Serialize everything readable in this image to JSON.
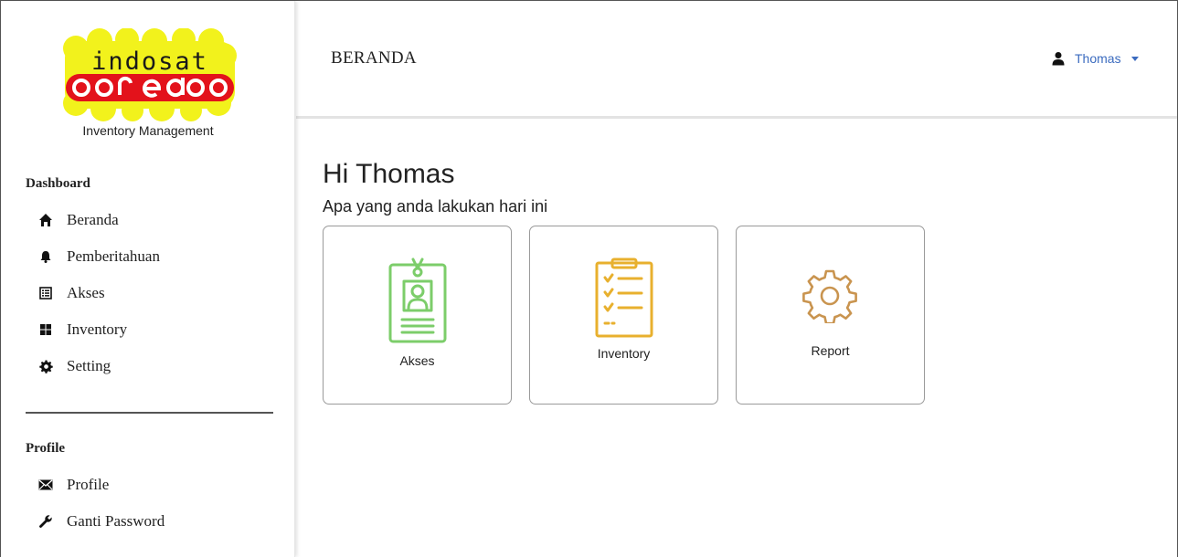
{
  "brand": {
    "logo_line1": "indosat",
    "logo_line2": "ooredoo",
    "caption": "Inventory Management"
  },
  "sidebar": {
    "sections": [
      {
        "title": "Dashboard",
        "items": [
          {
            "label": "Beranda",
            "icon": "home-icon"
          },
          {
            "label": "Pemberitahuan",
            "icon": "bell-icon"
          },
          {
            "label": "Akses",
            "icon": "list-icon"
          },
          {
            "label": "Inventory",
            "icon": "grid-icon"
          },
          {
            "label": "Setting",
            "icon": "gear-icon"
          }
        ]
      },
      {
        "title": "Profile",
        "items": [
          {
            "label": "Profile",
            "icon": "envelope-icon"
          },
          {
            "label": "Ganti Password",
            "icon": "wrench-icon"
          }
        ]
      }
    ]
  },
  "header": {
    "title": "BERANDA",
    "user_name": "Thomas"
  },
  "main": {
    "greeting": "Hi Thomas",
    "subtitle": "Apa yang anda lakukan hari ini",
    "cards": [
      {
        "label": "Akses",
        "icon": "id-badge-icon",
        "color": "#7ccd6a"
      },
      {
        "label": "Inventory",
        "icon": "clipboard-checklist-icon",
        "color": "#e8b02e"
      },
      {
        "label": "Report",
        "icon": "gear-icon",
        "color": "#c9944f"
      }
    ]
  },
  "colors": {
    "logo_yellow": "#f2f21c",
    "logo_red": "#e3121b",
    "link_blue": "#3b6bbf"
  }
}
